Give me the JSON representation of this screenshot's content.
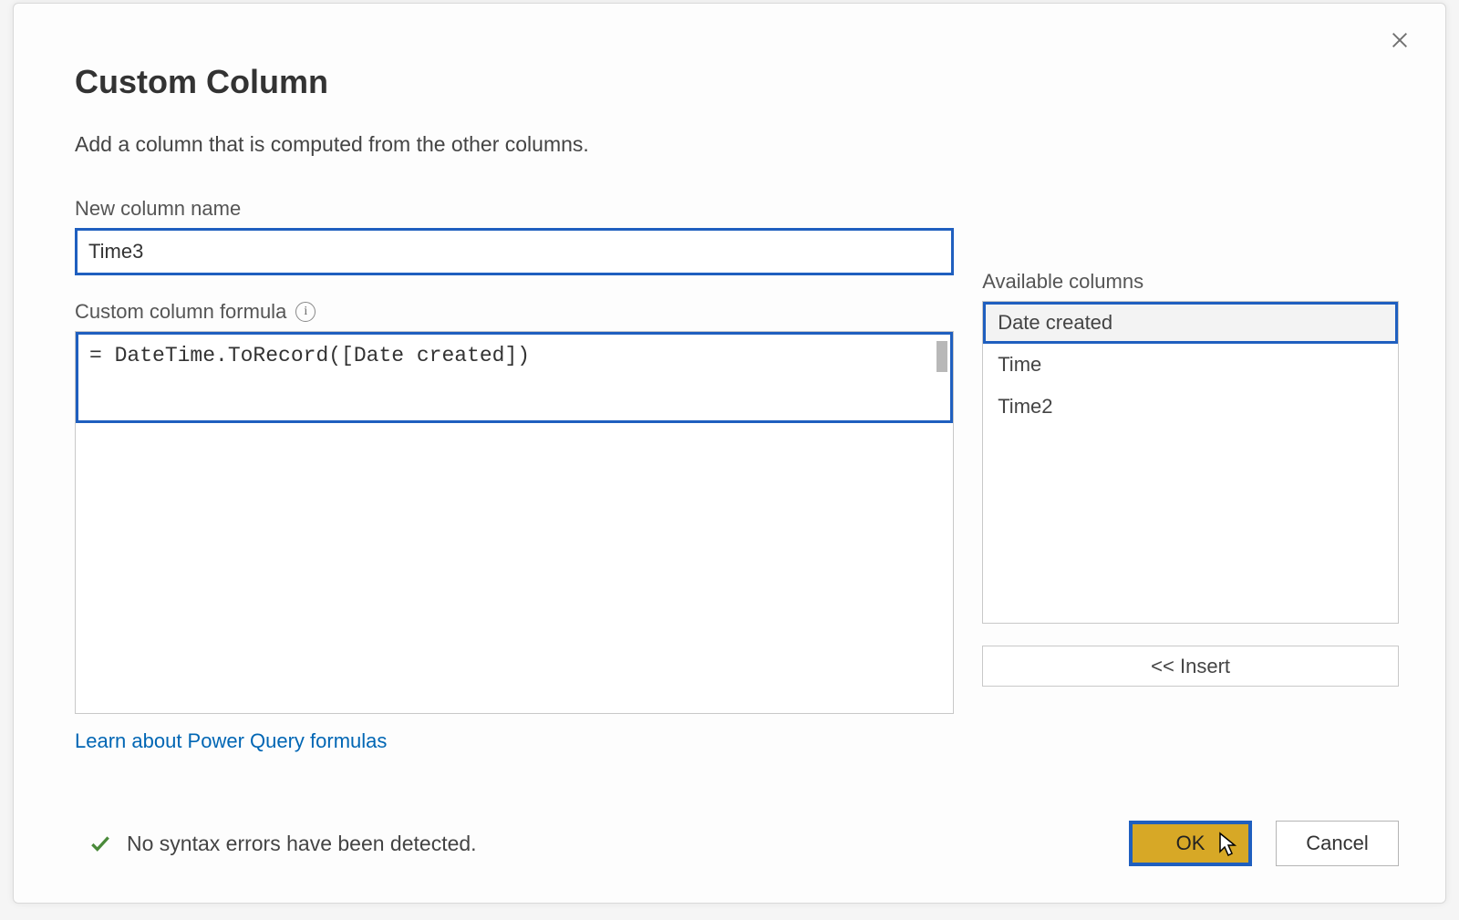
{
  "dialog": {
    "title": "Custom Column",
    "subtitle": "Add a column that is computed from the other columns.",
    "close_label": "Close"
  },
  "fields": {
    "column_name_label": "New column name",
    "column_name_value": "Time3",
    "formula_label": "Custom column formula",
    "formula_value": "= DateTime.ToRecord([Date created])",
    "available_label": "Available columns",
    "available_items": [
      "Date created",
      "Time",
      "Time2"
    ],
    "available_selected_index": 0,
    "insert_label": "<< Insert"
  },
  "link": {
    "learn_label": "Learn about Power Query formulas"
  },
  "status": {
    "message": "No syntax errors have been detected."
  },
  "buttons": {
    "ok": "OK",
    "cancel": "Cancel"
  }
}
